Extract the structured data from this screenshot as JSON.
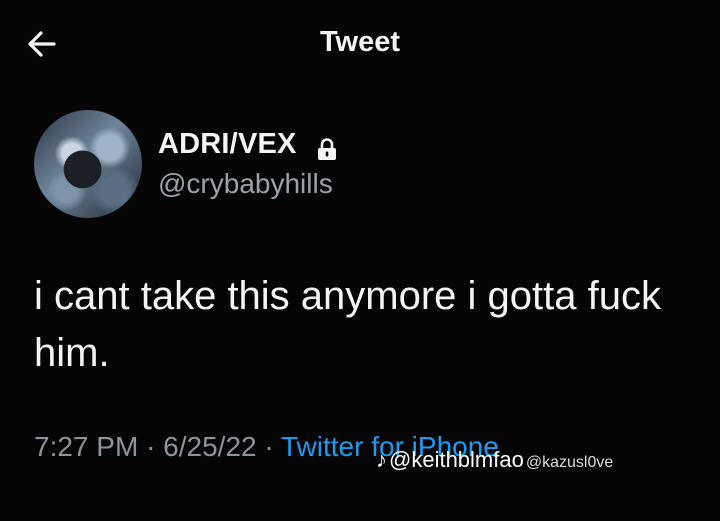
{
  "header": {
    "title": "Tweet",
    "back_icon": "arrow-left-icon"
  },
  "author": {
    "display_name": "ADRI/VEX",
    "username": "@crybabyhills",
    "protected_icon": "lock-icon"
  },
  "tweet": {
    "lines": [
      "i cant take this anymore i gotta fuck",
      "him."
    ]
  },
  "meta": {
    "time": "7:27 PM",
    "date": "6/25/22",
    "separator": "·",
    "source": "Twitter for iPhone"
  },
  "watermark": {
    "icon": "tiktok-icon",
    "handle_1": "@keithblmfao",
    "handle_2": "@kazusl0ve"
  },
  "colors": {
    "background": "#050505",
    "link": "#1d9bf0",
    "muted": "#8c959d"
  }
}
